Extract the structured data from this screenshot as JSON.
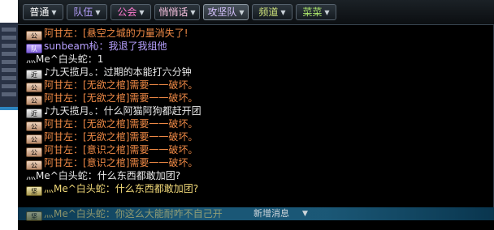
{
  "tabs": [
    {
      "label": "普通",
      "has_arrow": true,
      "color": "#ffffff"
    },
    {
      "label": "队伍",
      "has_arrow": true,
      "color": "#b7a0ff"
    },
    {
      "label": "公会",
      "has_arrow": true,
      "color": "#ff7ad0"
    },
    {
      "label": "悄悄话",
      "has_arrow": true,
      "color": "#ffc7e6"
    },
    {
      "label": "攻坚队",
      "has_arrow": true,
      "color": "#d7c3ff"
    },
    {
      "label": "频道",
      "has_arrow": true,
      "color": "#cde27a"
    },
    {
      "label": "菜菜",
      "has_arrow": true,
      "color": "#a9e36a"
    }
  ],
  "arrow_glyph": "▼",
  "messages": [
    {
      "channel": "guild",
      "speaker": "阿甘左",
      "text": "：[悬空之城的力量消失了!",
      "color": "#f08a46"
    },
    {
      "channel": "team",
      "speaker": "sunbeam杺",
      "text": "：我退了我组他",
      "color": "#b7a0ff"
    },
    {
      "channel": "none",
      "speaker": "灬Me^白头蛇",
      "text": "：1",
      "color": "#e8e8e8"
    },
    {
      "channel": "near",
      "speaker": "♪九天揽月。",
      "text": "：过期的本能打六分钟",
      "color": "#e8e8e8"
    },
    {
      "channel": "guild",
      "speaker": "阿甘左",
      "text": "：[无欲之棺]需要一一破坏。",
      "color": "#f08a46"
    },
    {
      "channel": "guild",
      "speaker": "阿甘左",
      "text": "：[无欲之棺]需要一一破坏。",
      "color": "#f08a46"
    },
    {
      "channel": "near",
      "speaker": "♪九天揽月。",
      "text": "：什么阿猫阿狗都赶开团",
      "color": "#e8e8e8"
    },
    {
      "channel": "guild",
      "speaker": "阿甘左",
      "text": "：[无欲之棺]需要一一破坏。",
      "color": "#f08a46"
    },
    {
      "channel": "guild",
      "speaker": "阿甘左",
      "text": "：[无欲之棺]需要一一破坏。",
      "color": "#f08a46"
    },
    {
      "channel": "guild",
      "speaker": "阿甘左",
      "text": "：[意识之棺]需要一一破坏。",
      "color": "#f08a46"
    },
    {
      "channel": "guild",
      "speaker": "阿甘左",
      "text": "：[意识之棺]需要一一破坏。",
      "color": "#f08a46"
    },
    {
      "channel": "none",
      "speaker": "灬Me^白头蛇",
      "text": "：什么东西都敢加团?",
      "color": "#e8e8e8"
    },
    {
      "channel": "team2",
      "speaker": "灬Me^白头蛇",
      "text": "：什么东西都敢加团?",
      "color": "#f0d878"
    },
    {
      "channel": "team2",
      "speaker": "灬Me^白头蛇",
      "text": "：你这么大能耐咋不自己开",
      "color": "#f0d878"
    }
  ],
  "new_message_bar": {
    "label": "新增消息",
    "icon": "down-arrow-icon"
  }
}
